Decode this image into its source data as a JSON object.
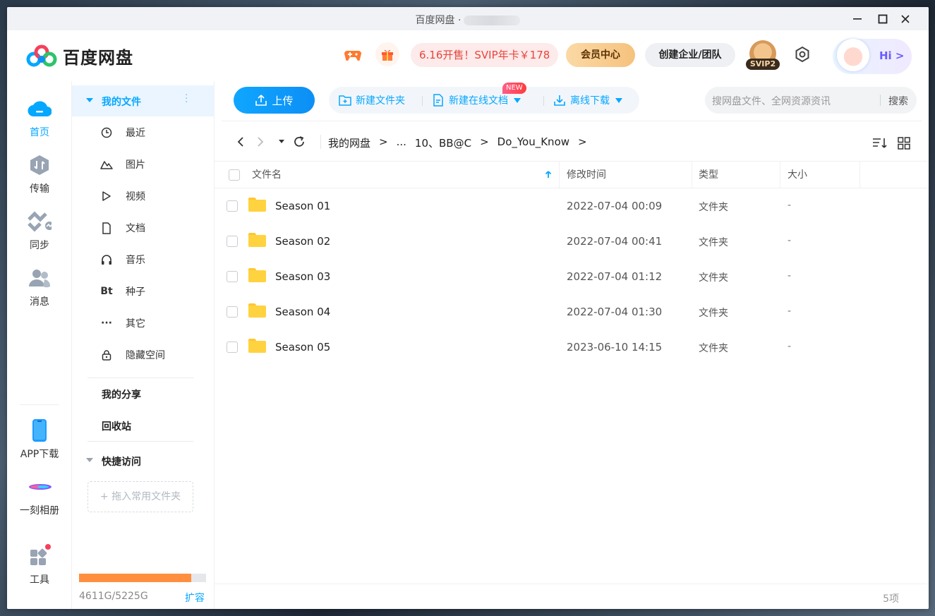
{
  "window": {
    "title": "百度网盘 ·"
  },
  "header": {
    "logo_text": "百度网盘",
    "promo": "6.16开售！SVIP年卡￥178",
    "vip_center": "会员中心",
    "business": "创建企业/团队",
    "svip_badge": "SVIP2",
    "hi": "Hi >"
  },
  "rail": {
    "items": [
      {
        "label": "首页",
        "icon": "cloud-home-icon"
      },
      {
        "label": "传输",
        "icon": "transfer-icon"
      },
      {
        "label": "同步",
        "icon": "sync-icon"
      },
      {
        "label": "消息",
        "icon": "message-icon"
      },
      {
        "label": "APP下载",
        "icon": "phone-icon"
      },
      {
        "label": "一刻相册",
        "icon": "album-icon"
      },
      {
        "label": "工具",
        "icon": "tools-icon"
      }
    ]
  },
  "sidebar": {
    "my_files": "我的文件",
    "items": [
      {
        "label": "最近",
        "icon": "clock-icon"
      },
      {
        "label": "图片",
        "icon": "image-icon"
      },
      {
        "label": "视频",
        "icon": "video-icon"
      },
      {
        "label": "文档",
        "icon": "document-icon"
      },
      {
        "label": "音乐",
        "icon": "headphones-icon"
      },
      {
        "label": "种子",
        "icon": "bt-icon",
        "glyph": "Bt"
      },
      {
        "label": "其它",
        "icon": "more-icon",
        "glyph": "···"
      },
      {
        "label": "隐藏空间",
        "icon": "lock-icon"
      }
    ],
    "my_share": "我的分享",
    "recycle": "回收站",
    "quick_access": "快捷访问",
    "drop_hint": "+ 拖入常用文件夹",
    "quota_used": "4611G/5225G",
    "quota_fraction": 0.882,
    "expand": "扩容"
  },
  "toolbar": {
    "upload": "上传",
    "new_folder": "新建文件夹",
    "new_doc": "新建在线文档",
    "new_badge": "NEW",
    "offline": "离线下载",
    "search_placeholder": "搜网盘文件、全网资源资讯",
    "search_btn": "搜索"
  },
  "breadcrumb": {
    "items": [
      "我的网盘",
      ">",
      "...",
      "10、BB@C",
      ">",
      "Do_You_Know",
      ">"
    ]
  },
  "table": {
    "columns": {
      "name": "文件名",
      "modified": "修改时间",
      "type": "类型",
      "size": "大小"
    },
    "rows": [
      {
        "name": "Season 01",
        "modified": "2022-07-04 00:09",
        "type": "文件夹",
        "size": "-"
      },
      {
        "name": "Season 02",
        "modified": "2022-07-04 00:41",
        "type": "文件夹",
        "size": "-"
      },
      {
        "name": "Season 03",
        "modified": "2022-07-04 01:12",
        "type": "文件夹",
        "size": "-"
      },
      {
        "name": "Season 04",
        "modified": "2022-07-04 01:30",
        "type": "文件夹",
        "size": "-"
      },
      {
        "name": "Season 05",
        "modified": "2023-06-10 14:15",
        "type": "文件夹",
        "size": "-"
      }
    ]
  },
  "footer": {
    "count": "5项"
  },
  "colors": {
    "accent": "#06a7ff",
    "quota": "#ff8f3f",
    "folder": "#ffd23f"
  }
}
